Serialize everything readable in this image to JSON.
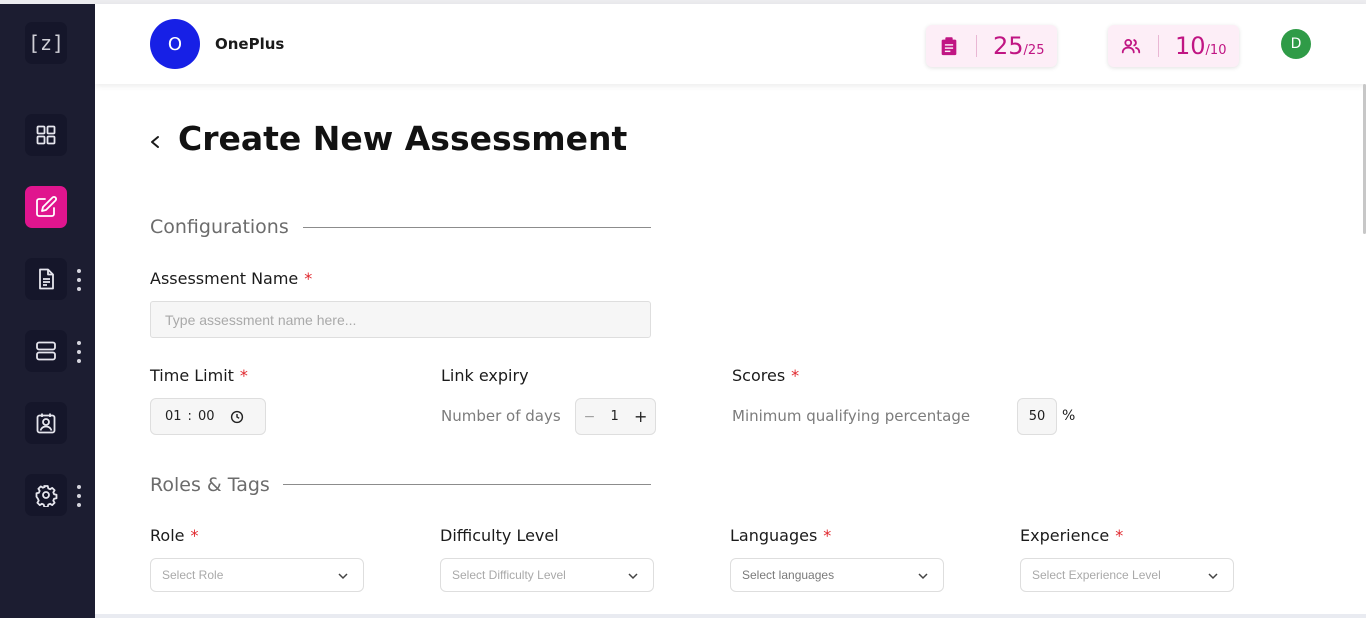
{
  "sidebar": {
    "logo": "[z]",
    "items": [
      {
        "icon": "dashboard-grid-icon",
        "has_menu": false,
        "active": false
      },
      {
        "icon": "edit-icon",
        "has_menu": false,
        "active": true
      },
      {
        "icon": "document-icon",
        "has_menu": true,
        "active": false
      },
      {
        "icon": "server-icon",
        "has_menu": true,
        "active": false
      },
      {
        "icon": "candidate-id-icon",
        "has_menu": false,
        "active": false
      },
      {
        "icon": "settings-gear-icon",
        "has_menu": true,
        "active": false
      }
    ]
  },
  "header": {
    "org_initial": "O",
    "org_name": "OnePlus",
    "assessments_stat": {
      "icon": "clipboard-icon",
      "value": "25",
      "total": "/25"
    },
    "users_stat": {
      "icon": "users-icon",
      "value": "10",
      "total": "/10"
    },
    "user_initial": "D"
  },
  "page": {
    "title": "Create New Assessment"
  },
  "configurations": {
    "section_title": "Configurations",
    "assessment_name_label": "Assessment Name",
    "assessment_name_placeholder": "Type assessment name here...",
    "time_limit_label": "Time Limit",
    "time_hours": "01",
    "time_separator": ":",
    "time_minutes": "00",
    "link_expiry_label": "Link expiry",
    "days_label": "Number of days",
    "days_value": "1",
    "scores_label": "Scores",
    "min_pct_label": "Minimum qualifying percentage",
    "min_pct_value": "50",
    "pct_sign": "%"
  },
  "roles_tags": {
    "section_title": "Roles & Tags",
    "role_label": "Role",
    "role_placeholder": "Select Role",
    "difficulty_label": "Difficulty Level",
    "difficulty_placeholder": "Select Difficulty Level",
    "languages_label": "Languages",
    "languages_placeholder": "Select languages",
    "experience_label": "Experience",
    "experience_placeholder": "Select Experience Level"
  },
  "required_marker": "*",
  "colors": {
    "sidebar_bg": "#1c1d31",
    "accent": "#e0158e",
    "stat_text": "#c01583",
    "org_avatar": "#1720e6",
    "user_avatar": "#2f9b47",
    "required": "#e0272d"
  }
}
